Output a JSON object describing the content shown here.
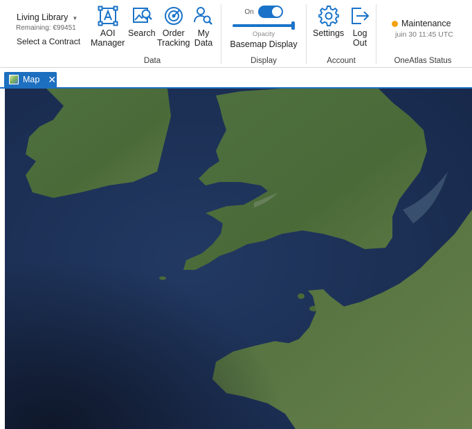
{
  "contract": {
    "name": "Living Library",
    "remaining": "Remaining: €99451",
    "select_label": "Select a Contract"
  },
  "groups": {
    "data": "Data",
    "display": "Display",
    "account": "Account",
    "status": "OneAtlas Status"
  },
  "tools": {
    "aoi_manager": "AOI\nManager",
    "search": "Search",
    "order_tracking": "Order\nTracking",
    "my_data": "My\nData",
    "settings": "Settings",
    "log_out": "Log\nOut"
  },
  "display": {
    "toggle_label": "On",
    "toggle_state": true,
    "opacity_label": "Opacity",
    "opacity_value": 1.0,
    "basemap_label": "Basemap Display"
  },
  "status": {
    "state": "Maintenance",
    "timestamp": "juin 30 11:45 UTC",
    "color": "#f4a20e"
  },
  "tab": {
    "label": "Map",
    "close": "✕",
    "icon": "map-thumbnail-icon"
  },
  "colors": {
    "accent": "#1a73c9",
    "tab": "#1d6fbf",
    "sea": "#1e2f52",
    "land": "#4a6b3a"
  }
}
